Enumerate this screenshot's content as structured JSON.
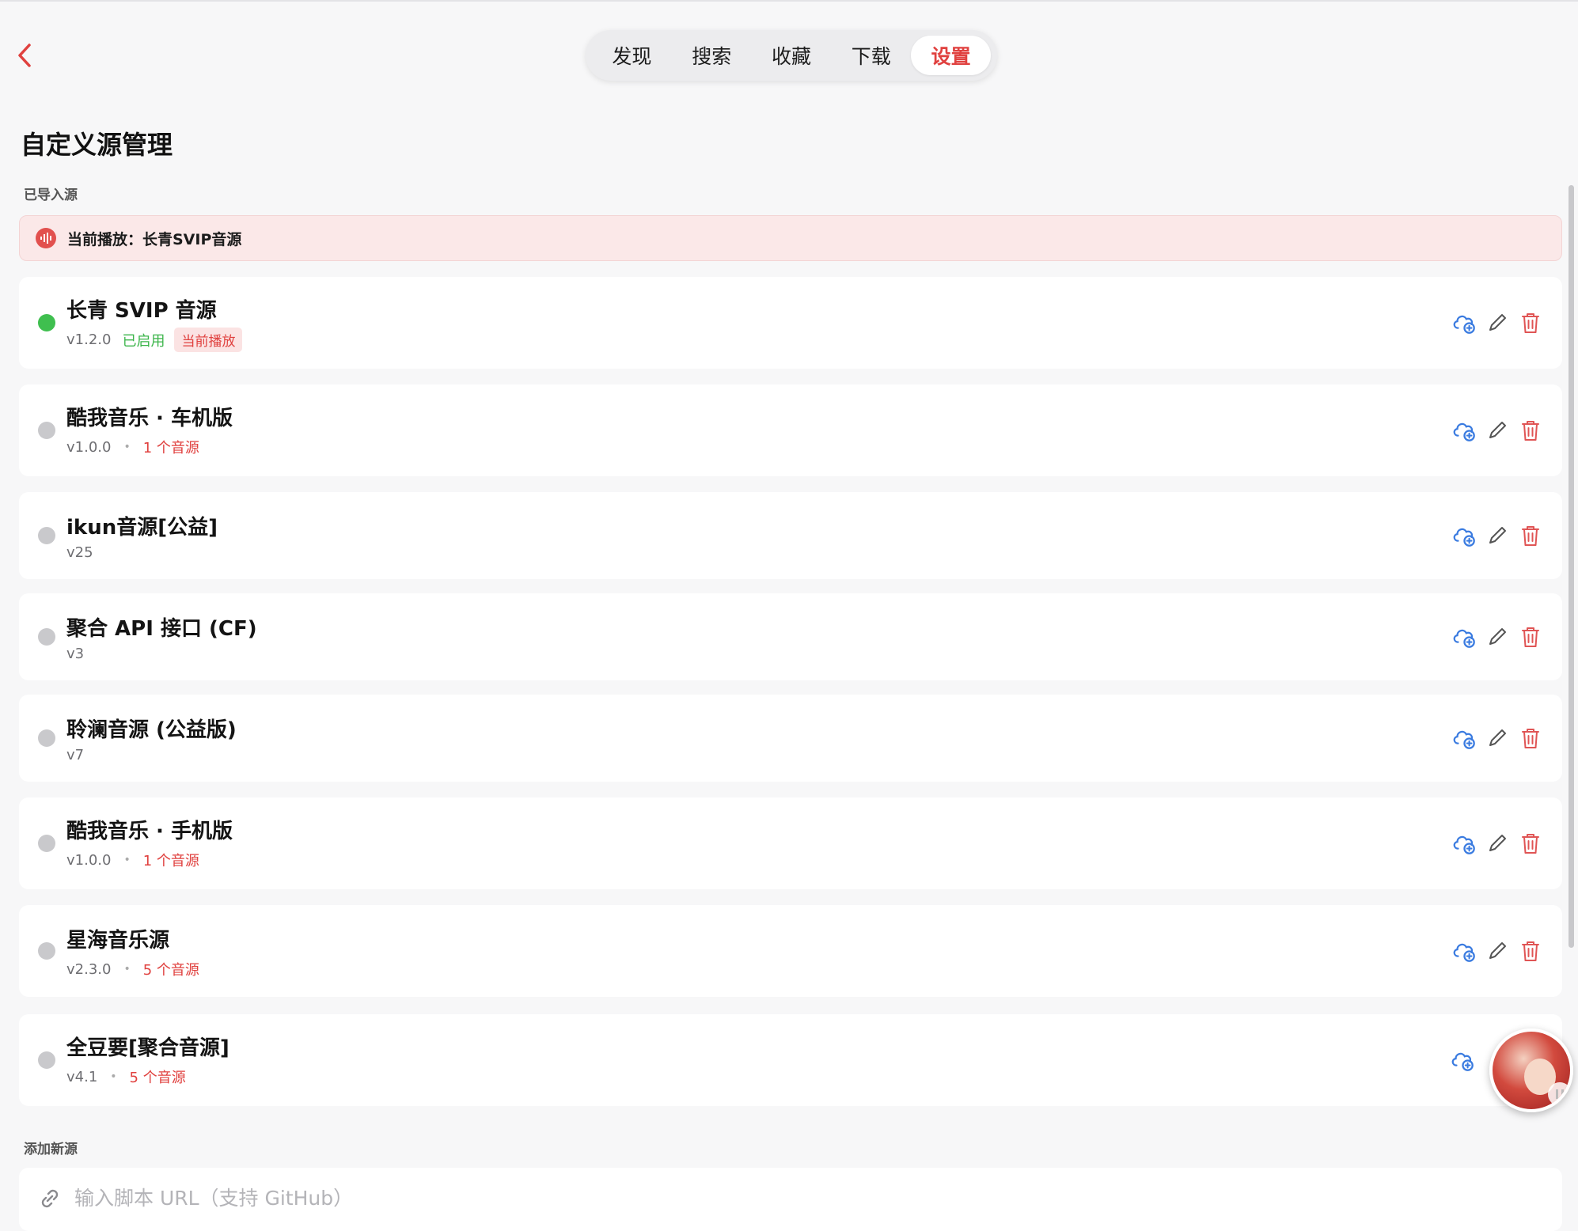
{
  "nav": {
    "tabs": [
      {
        "label": "发现"
      },
      {
        "label": "搜索"
      },
      {
        "label": "收藏"
      },
      {
        "label": "下载"
      },
      {
        "label": "设置"
      }
    ],
    "active_tab": "设置"
  },
  "page": {
    "title": "自定义源管理",
    "imported_label": "已导入源",
    "add_label": "添加新源"
  },
  "now_playing": {
    "text": "当前播放：长青SVIP音源"
  },
  "sources": [
    {
      "name": "长青 SVIP 音源",
      "version": "v1.2.0",
      "enabled": "已启用",
      "badge": "当前播放"
    },
    {
      "name": "酷我音乐 · 车机版",
      "version": "v1.0.0",
      "count": "1 个音源"
    },
    {
      "name": "ikun音源[公益]",
      "version": "v25"
    },
    {
      "name": "聚合 API 接口 (CF)",
      "version": "v3"
    },
    {
      "name": "聆澜音源 (公益版)",
      "version": "v7"
    },
    {
      "name": "酷我音乐 · 手机版",
      "version": "v1.0.0",
      "count": "1 个音源"
    },
    {
      "name": "星海音乐源",
      "version": "v2.3.0",
      "count": "5 个音源"
    },
    {
      "name": "全豆要[聚合音源]",
      "version": "v4.1",
      "count": "5 个音源"
    }
  ],
  "add_source": {
    "placeholder": "输入脚本 URL（支持 GitHub）"
  },
  "colors": {
    "accent": "#e0413f",
    "enabled": "#3bb54a",
    "action_blue": "#3a7be0"
  },
  "icons": {
    "back": "chevron-left-icon",
    "cloud_link": "cloud-link-icon",
    "edit": "pencil-icon",
    "delete": "trash-icon",
    "link": "link-icon"
  }
}
